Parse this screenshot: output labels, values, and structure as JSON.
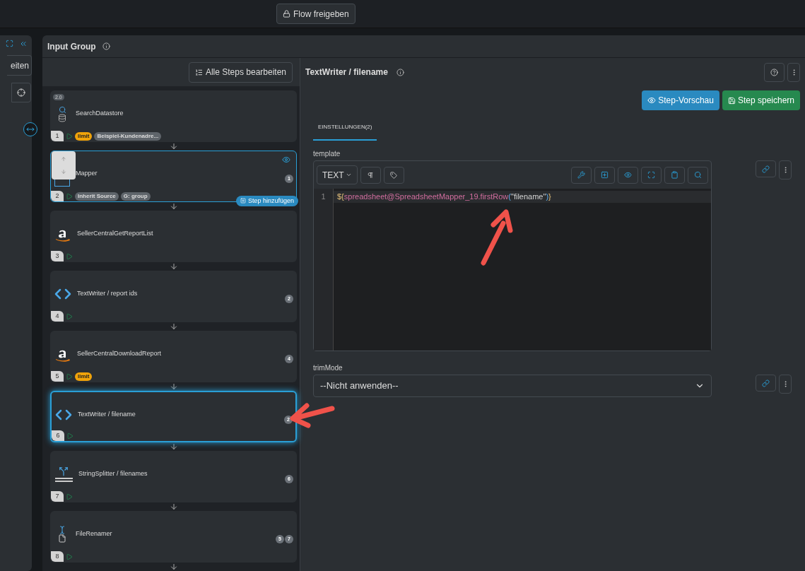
{
  "top_bar": {
    "share_button": "Flow freigeben"
  },
  "side_panel": {
    "button_fragment": "eiten"
  },
  "group": {
    "title": "Input Group",
    "edit_all_button": "Alle Steps bearbeiten"
  },
  "steps": [
    {
      "number": "1",
      "name": "SearchDatastore",
      "kind": "search",
      "version": "2.0",
      "tags": [
        {
          "label": "limit",
          "kind": "limit"
        },
        {
          "label": "Beispiel-Kundenadre...",
          "kind": "plain"
        }
      ],
      "selected": false,
      "hovered": false
    },
    {
      "number": "2",
      "name": "Mapper",
      "kind": "mapper",
      "tags": [
        {
          "label": "Inherit Source",
          "kind": "plain"
        },
        {
          "label": "G: group",
          "kind": "plain"
        }
      ],
      "inputs": [
        "1"
      ],
      "selected": false,
      "hovered": true,
      "add_button": "Step hinzufügen"
    },
    {
      "number": "3",
      "name": "SellerCentralGetReportList",
      "kind": "amazon",
      "selected": false,
      "hovered": false
    },
    {
      "number": "4",
      "name": "TextWriter / report ids",
      "kind": "writer",
      "inputs": [
        "2"
      ],
      "selected": false,
      "hovered": false
    },
    {
      "number": "5",
      "name": "SellerCentralDownloadReport",
      "kind": "amazon",
      "tags": [
        {
          "label": "limit",
          "kind": "limit"
        }
      ],
      "inputs": [
        "4"
      ],
      "selected": false,
      "hovered": false
    },
    {
      "number": "6",
      "name": "TextWriter / filename",
      "kind": "writer",
      "inputs": [
        "2"
      ],
      "selected": true,
      "hovered": false
    },
    {
      "number": "7",
      "name": "StringSplitter / filenames",
      "kind": "splitter",
      "inputs": [
        "6"
      ],
      "selected": false,
      "hovered": false
    },
    {
      "number": "8",
      "name": "FileRenamer",
      "kind": "renamer",
      "inputs": [
        "5",
        "7"
      ],
      "selected": false,
      "hovered": false
    }
  ],
  "detail": {
    "title": "TextWriter / filename",
    "preview_button": "Step-Vorschau",
    "save_button": "Step speichern",
    "tabs": [
      {
        "label": "EINSTELLUNGEN(2)",
        "selected": true
      }
    ],
    "template": {
      "label": "template",
      "mode": "TEXT",
      "line_numbers": [
        "1"
      ],
      "tokens": [
        {
          "text": "${",
          "kind": "brace"
        },
        {
          "text": "spreadsheet@SpreadsheetMapper_19.firstRow",
          "kind": "ident"
        },
        {
          "text": "(",
          "kind": "paren"
        },
        {
          "text": "\"filename\"",
          "kind": "string"
        },
        {
          "text": ")",
          "kind": "paren"
        },
        {
          "text": "}",
          "kind": "brace"
        }
      ]
    },
    "trim_mode": {
      "label": "trimMode",
      "value": "--Nicht anwenden--"
    }
  }
}
